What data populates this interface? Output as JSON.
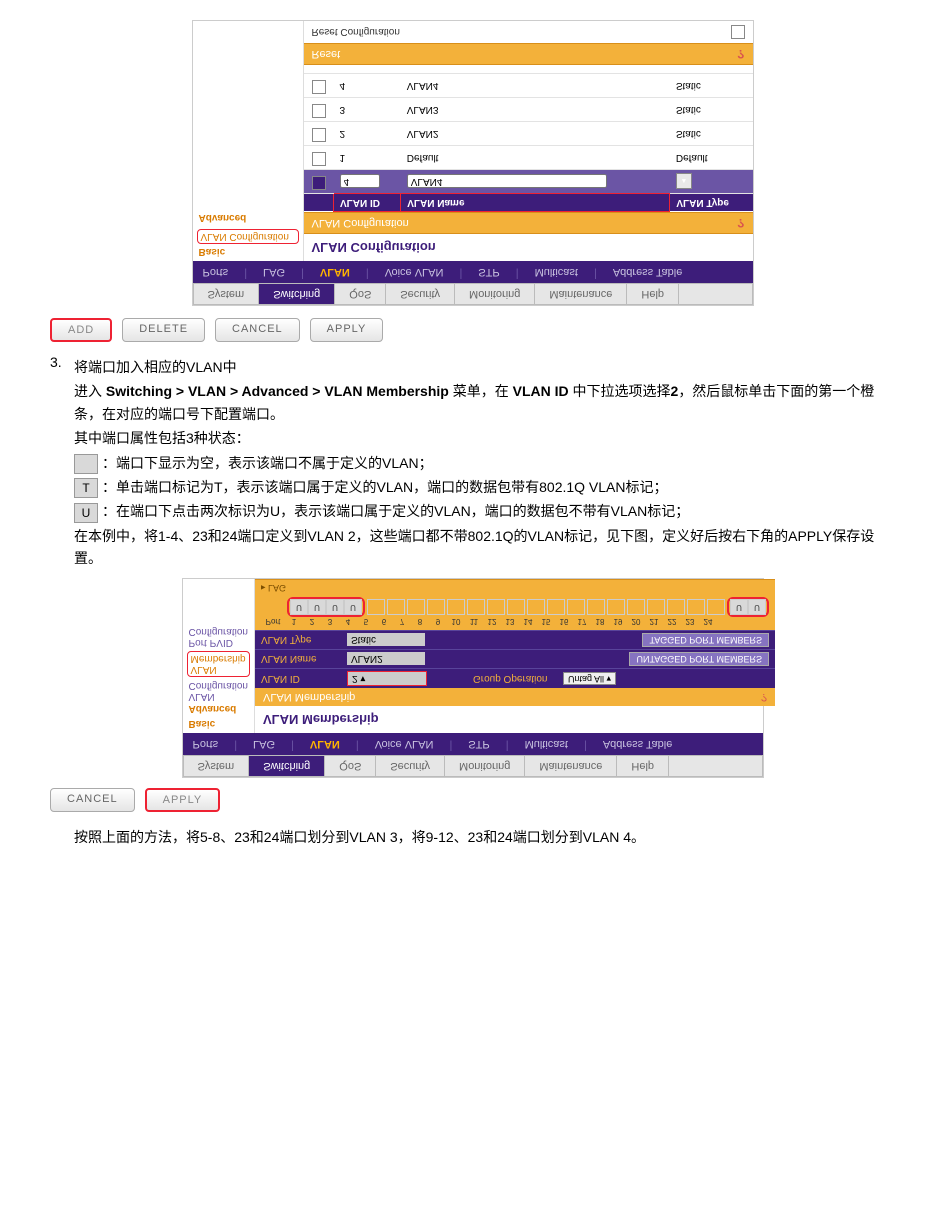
{
  "shot1": {
    "flipped": true,
    "tabs_top": [
      "System",
      "Switching",
      "QoS",
      "Security",
      "Monitoring",
      "Maintenance",
      "Help"
    ],
    "tabs_top_active": "Switching",
    "tabs_sub": [
      "Ports",
      "LAG",
      "VLAN",
      "Voice VLAN",
      "STP",
      "Multicast",
      "Address Table"
    ],
    "tabs_sub_active": "VLAN",
    "side": {
      "group1": "Basic",
      "item1": "VLAN Configuration",
      "group2": "Advanced"
    },
    "title": "VLAN Configuration",
    "panel_header": "VLAN Configuration",
    "columns": {
      "c0": "",
      "c1": "VLAN ID",
      "c2": "VLAN Name",
      "c3": "VLAN Type"
    },
    "editrow": {
      "id": "4",
      "name": "VLAN4"
    },
    "rows": [
      {
        "id": "1",
        "name": "Default",
        "type": "Default"
      },
      {
        "id": "2",
        "name": "VLAN2",
        "type": "Static"
      },
      {
        "id": "3",
        "name": "VLAN3",
        "type": "Static"
      },
      {
        "id": "4",
        "name": "VLAN4",
        "type": "Static"
      }
    ],
    "reset_panel": "Reset",
    "reset_label": "Reset Configuration"
  },
  "buttons1": {
    "add": "ADD",
    "delete": "DELETE",
    "cancel": "CANCEL",
    "apply": "APPLY"
  },
  "step3": {
    "num": "3.",
    "heading": "将端口加入相应的VLAN中",
    "line1_a": "进入 ",
    "line1_b": "Switching > VLAN > Advanced > VLAN Membership",
    "line1_c": " 菜单，在 ",
    "line1_d": "VLAN ID",
    "line1_e": " 中下拉选项选择",
    "line1_f": "2",
    "line1_g": "，然后鼠标单击下面的第一个橙条，在对应的端口号下配置端口。",
    "line2": "其中端口属性包括3种状态：",
    "blank_label": "",
    "blank_desc": "：端口下显示为空，表示该端口不属于定义的VLAN；",
    "t_label": "T",
    "t_desc": "：单击端口标记为T，表示该端口属于定义的VLAN，端口的数据包带有802.1Q VLAN标记；",
    "u_label": "U",
    "u_desc": "：在端口下点击两次标识为U，表示该端口属于定义的VLAN，端口的数据包不带有VLAN标记；",
    "ex1": "在本例中，将1-4、23和24端口定义到VLAN 2，这些端口都不带802.1Q的VLAN标记，见下图，定义好后按右下角的APPLY保存设置。"
  },
  "shot2": {
    "flipped": true,
    "tabs_top": [
      "System",
      "Switching",
      "QoS",
      "Security",
      "Monitoring",
      "Maintenance",
      "Help"
    ],
    "tabs_top_active": "Switching",
    "tabs_sub": [
      "Ports",
      "LAG",
      "VLAN",
      "Voice VLAN",
      "STP",
      "Multicast",
      "Address Table"
    ],
    "tabs_sub_active": "VLAN",
    "side": {
      "group1": "Basic",
      "group2": "Advanced",
      "item1": "VLAN Configuration",
      "item2": "VLAN Membership",
      "item3": "Port PVID Configuration"
    },
    "title": "VLAN Membership",
    "panel_header": "VLAN Membership",
    "cfg": {
      "vlan_id_lbl": "VLAN ID",
      "vlan_id_val": "2",
      "grp_op_lbl": "Group Operation",
      "grp_op_val": "Untag All",
      "vlan_name_lbl": "VLAN Name",
      "vlan_name_val": "VLAN2",
      "unt_btn": "UNTAGGED PORT MEMBERS",
      "vlan_type_lbl": "VLAN Type",
      "vlan_type_val": "Static",
      "tag_btn": "TAGGED PORT MEMBERS"
    },
    "port_label": "Port",
    "lag_label": "LAG",
    "u": "U",
    "ports": [
      "1",
      "2",
      "3",
      "4",
      "5",
      "6",
      "7",
      "8",
      "9",
      "10",
      "11",
      "12",
      "13",
      "14",
      "15",
      "16",
      "17",
      "18",
      "19",
      "20",
      "21",
      "22",
      "23",
      "24"
    ]
  },
  "buttons2": {
    "cancel": "CANCEL",
    "apply": "APPLY"
  },
  "tail": "按照上面的方法，将5-8、23和24端口划分到VLAN 3，将9-12、23和24端口划分到VLAN 4。"
}
